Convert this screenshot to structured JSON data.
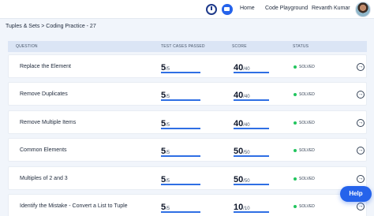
{
  "nav": {
    "home": "Home",
    "playground": "Code Playground",
    "user_name": "Revanth Kumar",
    "timer_icon": "stopwatch-icon",
    "chat_icon": "chat-icon"
  },
  "breadcrumb": "Tuples & Sets > Coding Practice - 27",
  "table": {
    "headers": {
      "question": "QUESTION",
      "tests": "TEST CASES PASSED",
      "score": "SCORE",
      "status": "STATUS"
    },
    "rows": [
      {
        "title": "Replace the Element",
        "passed": "5",
        "total": "/5",
        "score": "40",
        "max": "/40",
        "progress": 1.0,
        "status": "SOLVED"
      },
      {
        "title": "Remove Duplicates",
        "passed": "5",
        "total": "/5",
        "score": "40",
        "max": "/40",
        "progress": 1.0,
        "status": "SOLVED"
      },
      {
        "title": "Remove Multiple Items",
        "passed": "5",
        "total": "/5",
        "score": "40",
        "max": "/40",
        "progress": 1.0,
        "status": "SOLVED"
      },
      {
        "title": "Common Elements",
        "passed": "5",
        "total": "/5",
        "score": "50",
        "max": "/50",
        "progress": 1.0,
        "status": "SOLVED"
      },
      {
        "title": "Multiples of 2 and 3",
        "passed": "5",
        "total": "/5",
        "score": "50",
        "max": "/50",
        "progress": 1.0,
        "status": "SOLVED"
      },
      {
        "title": "Identify the Mistake - Convert a List to Tuple",
        "passed": "5",
        "total": "/5",
        "score": "10",
        "max": "/10",
        "progress": 1.0,
        "status": "SOLVED"
      }
    ]
  },
  "help_label": "Help",
  "colors": {
    "accent": "#2f6fe4",
    "solved": "#22c55e",
    "header_bg": "#dbe5f5",
    "page_bg": "#f1f5fb"
  }
}
